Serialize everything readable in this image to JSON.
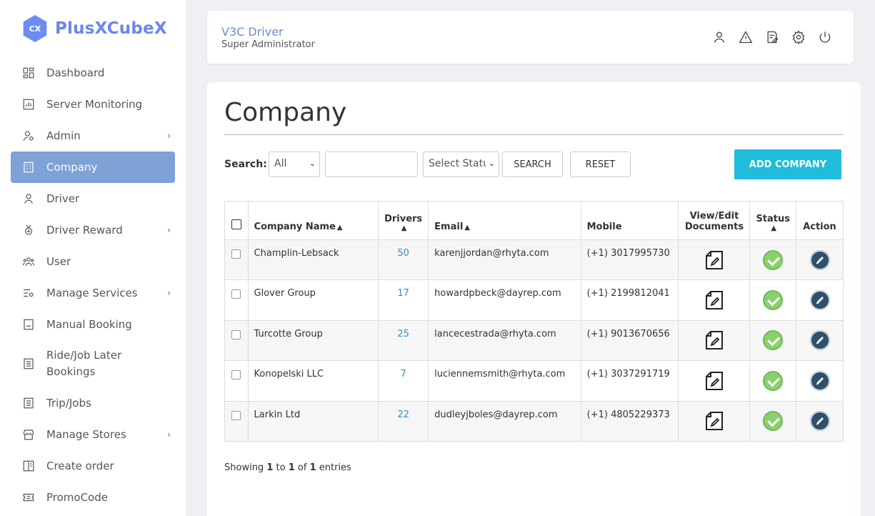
{
  "brand": {
    "logo_badge": "CX",
    "name": "PlusXCubeX"
  },
  "sidebar": {
    "items": [
      {
        "label": "Dashboard",
        "icon": "dashboard-icon",
        "active": false,
        "has_submenu": false
      },
      {
        "label": "Server Monitoring",
        "icon": "chart-icon",
        "active": false,
        "has_submenu": false
      },
      {
        "label": "Admin",
        "icon": "admin-icon",
        "active": false,
        "has_submenu": true
      },
      {
        "label": "Company",
        "icon": "building-icon",
        "active": true,
        "has_submenu": false
      },
      {
        "label": "Driver",
        "icon": "driver-icon",
        "active": false,
        "has_submenu": false
      },
      {
        "label": "Driver Reward",
        "icon": "medal-icon",
        "active": false,
        "has_submenu": true
      },
      {
        "label": "User",
        "icon": "users-icon",
        "active": false,
        "has_submenu": false
      },
      {
        "label": "Manage Services",
        "icon": "services-icon",
        "active": false,
        "has_submenu": true
      },
      {
        "label": "Manual Booking",
        "icon": "booking-icon",
        "active": false,
        "has_submenu": false
      },
      {
        "label": "Ride/Job Later Bookings",
        "icon": "list-icon",
        "active": false,
        "has_submenu": false
      },
      {
        "label": "Trip/Jobs",
        "icon": "trip-icon",
        "active": false,
        "has_submenu": false
      },
      {
        "label": "Manage Stores",
        "icon": "store-icon",
        "active": false,
        "has_submenu": true
      },
      {
        "label": "Create order",
        "icon": "order-icon",
        "active": false,
        "has_submenu": false
      },
      {
        "label": "PromoCode",
        "icon": "ticket-icon",
        "active": false,
        "has_submenu": false
      }
    ]
  },
  "header": {
    "title": "V3C Driver",
    "subtitle": "Super Administrator",
    "icons": [
      "user-icon",
      "alert-icon",
      "edit-note-icon",
      "settings-icon",
      "power-icon"
    ]
  },
  "page": {
    "title": "Company",
    "search_label": "Search:",
    "filter_select": "All",
    "search_input_value": "",
    "status_select": "Select Status",
    "search_button": "SEARCH",
    "reset_button": "RESET",
    "add_button": "ADD COMPANY"
  },
  "table": {
    "headers": {
      "company_name": "Company Name",
      "drivers": "Drivers",
      "email": "Email",
      "mobile": "Mobile",
      "documents_line1": "View/Edit",
      "documents_line2": "Documents",
      "status": "Status",
      "action": "Action"
    },
    "rows": [
      {
        "company": "Champlin-Lebsack",
        "drivers": "50",
        "email": "karenjjordan@rhyta.com",
        "mobile": "(+1) 3017995730",
        "status": "active"
      },
      {
        "company": "Glover Group",
        "drivers": "17",
        "email": "howardpbeck@dayrep.com",
        "mobile": "(+1) 2199812041",
        "status": "active"
      },
      {
        "company": "Turcotte Group",
        "drivers": "25",
        "email": "lancecestrada@rhyta.com",
        "mobile": "(+1) 9013670656",
        "status": "active"
      },
      {
        "company": "Konopelski LLC",
        "drivers": "7",
        "email": "luciennemsmith@rhyta.com",
        "mobile": "(+1) 3037291719",
        "status": "active"
      },
      {
        "company": "Larkin Ltd",
        "drivers": "22",
        "email": "dudleyjboles@dayrep.com",
        "mobile": "(+1) 4805229373",
        "status": "active"
      }
    ]
  },
  "footer": {
    "showing_prefix": "Showing",
    "from": "1",
    "to_word": "to",
    "to": "1",
    "of_word": "of",
    "total": "1",
    "suffix": "entries"
  },
  "colors": {
    "accent": "#7ea1d6",
    "brand": "#6d86e8",
    "add_button": "#1fbcdb",
    "status_ok": "#8bd06f",
    "edit_button": "#2f4f6a",
    "link": "#3b8ac4"
  }
}
